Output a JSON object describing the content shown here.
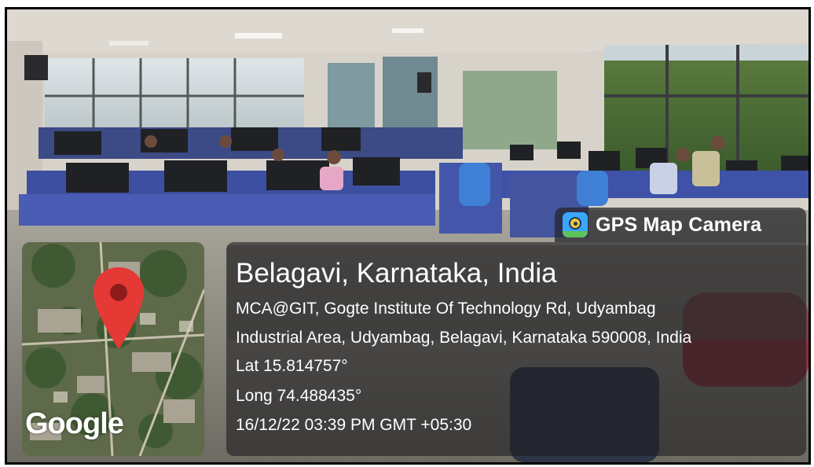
{
  "badge": {
    "icon": "gps-map-camera-app-icon",
    "label": "GPS Map Camera"
  },
  "map": {
    "marker_icon": "location-pin-icon",
    "logo": "Google"
  },
  "location": {
    "title": "Belagavi, Karnataka, India",
    "address_line1": "MCA@GIT, Gogte Institute Of Technology Rd, Udyambag",
    "address_line2": "Industrial Area, Udyambag, Belagavi, Karnataka 590008, India",
    "lat": "Lat 15.814757°",
    "long": "Long 74.488435°",
    "datetime": "16/12/22 03:39 PM GMT +05:30"
  },
  "colors": {
    "overlay": "#1e1e22",
    "pin_red": "#e53935",
    "badge_icon_bg": "#3aa7ff"
  }
}
